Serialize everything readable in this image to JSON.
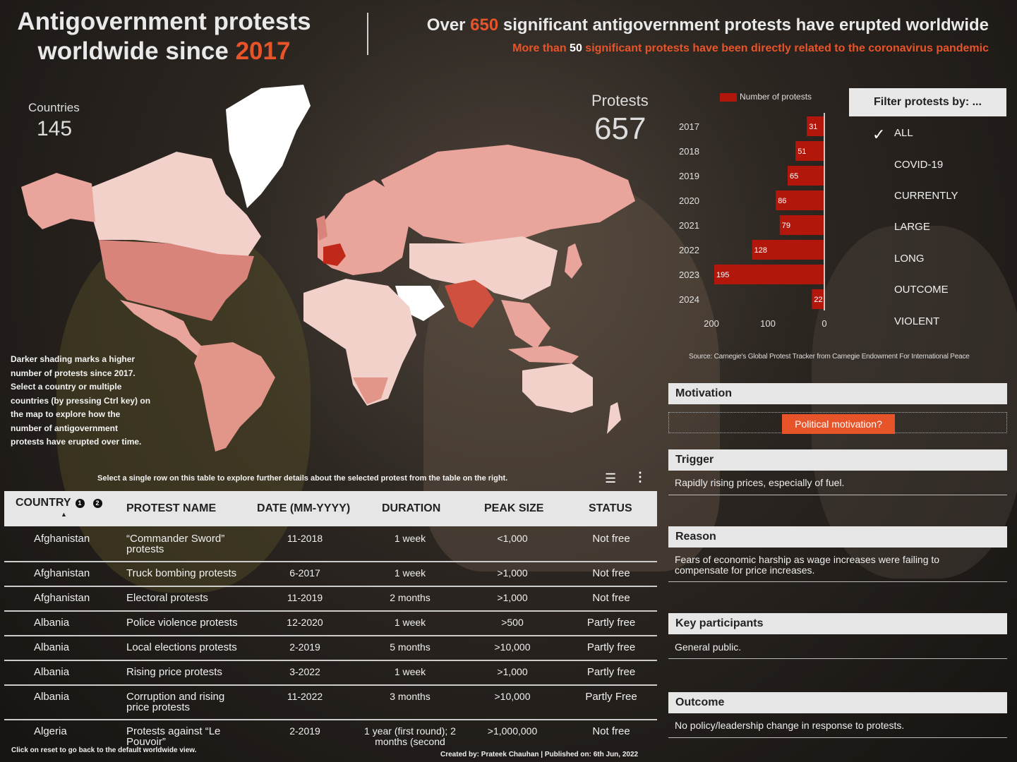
{
  "title": {
    "line1": "Antigovernment protests",
    "line2_prefix": "worldwide since ",
    "line2_year": "2017"
  },
  "headline": {
    "prefix": "Over ",
    "count": "650",
    "suffix": " significant antigovernment protests have erupted worldwide"
  },
  "subheadline": {
    "prefix": "More than ",
    "count": "50",
    "suffix": " significant protests have been directly related to the coronavirus pandemic"
  },
  "kpis": {
    "countries_label": "Countries",
    "countries_value": "145",
    "protests_label": "Protests",
    "protests_value": "657"
  },
  "map_note": "Darker shading marks a higher number of protests since 2017. Select a country or multiple countries (by pressing Ctrl key) on the map to explore how the number of antigovernment protests have erupted over time.",
  "chart_legend": "Number of protests",
  "chart_data": {
    "type": "bar",
    "orientation": "horizontal",
    "categories": [
      "2017",
      "2018",
      "2019",
      "2020",
      "2021",
      "2022",
      "2023",
      "2024"
    ],
    "values": [
      31,
      51,
      65,
      86,
      79,
      128,
      195,
      22
    ],
    "xticks": [
      "200",
      "100",
      "0"
    ],
    "xlim": [
      0,
      200
    ],
    "color": "#b3170c"
  },
  "source": "Source: Carnegie's Global Protest Tracker from Carnegie Endowment For International Peace",
  "filter": {
    "title": "Filter protests by: ...",
    "options": [
      "ALL",
      "COVID-19",
      "CURRENTLY",
      "LARGE",
      "LONG",
      "OUTCOME",
      "VIOLENT"
    ],
    "selected": "ALL"
  },
  "details": {
    "motivation_title": "Motivation",
    "motivation_value": "Political motivation?",
    "trigger_title": "Trigger",
    "trigger_value": "Rapidly rising prices, especially of fuel.",
    "reason_title": "Reason",
    "reason_value": "Fears of economic harship as wage increases were failing to compensate for price increases.",
    "participants_title": "Key participants",
    "participants_value": "General public.",
    "outcome_title": "Outcome",
    "outcome_value": "No policy/leadership change in response to protests."
  },
  "table_hint": "Select a single row on this table to explore further details about the selected protest from the table on the right.",
  "table": {
    "headers": [
      "COUNTRY",
      "PROTEST NAME",
      "DATE (MM-YYYY)",
      "DURATION",
      "PEAK SIZE",
      "STATUS"
    ],
    "badges": [
      "1",
      "2"
    ],
    "rows": [
      [
        "Afghanistan",
        "“Commander Sword” protests",
        "11-2018",
        "1 week",
        "<1,000",
        "Not free"
      ],
      [
        "Afghanistan",
        "Truck bombing protests",
        "6-2017",
        "1 week",
        ">1,000",
        "Not free"
      ],
      [
        "Afghanistan",
        "Electoral protests",
        "11-2019",
        "2 months",
        ">1,000",
        "Not free"
      ],
      [
        "Albania",
        "Police violence protests",
        "12-2020",
        "1 week",
        ">500",
        "Partly free"
      ],
      [
        "Albania",
        "Local elections protests",
        "2-2019",
        "5 months",
        ">10,000",
        "Partly free"
      ],
      [
        "Albania",
        "Rising price protests",
        "3-2022",
        "1 week",
        ">1,000",
        "Partly free"
      ],
      [
        "Albania",
        "Corruption and rising price protests",
        "11-2022",
        "3 months",
        ">10,000",
        "Partly Free"
      ],
      [
        "Algeria",
        "Protests against “Le Pouvoir”",
        "2-2019",
        "1 year (first round); 2 months (second",
        ">1,000,000",
        "Not free"
      ]
    ]
  },
  "footer_left": "Click on reset to go back to the default worldwide view.",
  "footer_right": "Created by: Prateek Chauhan | Published on: 6th Jun, 2022"
}
